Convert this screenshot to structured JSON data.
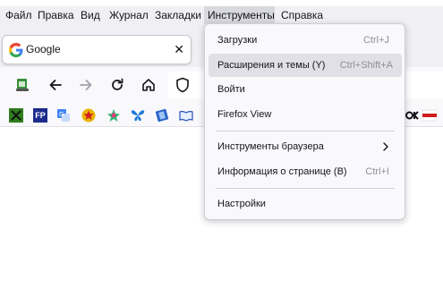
{
  "menubar": {
    "items": [
      {
        "label": "Файл"
      },
      {
        "label": "Правка"
      },
      {
        "label": "Вид"
      },
      {
        "label": "Журнал"
      },
      {
        "label": "Закладки"
      },
      {
        "label": "Инструменты"
      },
      {
        "label": "Справка"
      }
    ]
  },
  "tab": {
    "title": "Google",
    "close_glyph": "✕"
  },
  "tools_menu": {
    "items": [
      {
        "label": "Загрузки",
        "shortcut": "Ctrl+J"
      },
      {
        "label": "Расширения и темы (Y)",
        "shortcut": "Ctrl+Shift+A"
      },
      {
        "label": "Войти",
        "shortcut": ""
      },
      {
        "label": "Firefox View",
        "shortcut": ""
      },
      {
        "label": "Инструменты браузера",
        "shortcut": ""
      },
      {
        "label": "Информация о странице (B)",
        "shortcut": "Ctrl+I"
      },
      {
        "label": "Настройки",
        "shortcut": ""
      }
    ]
  },
  "bookmarks": {
    "fp_label": "FP"
  },
  "colors": {
    "menu_bg": "#f9f9fb",
    "hover_bg": "#e0e0e6",
    "chrome_bg": "#f0f0f4",
    "text": "#15141a",
    "shortcut_text": "#8f8f9d"
  }
}
